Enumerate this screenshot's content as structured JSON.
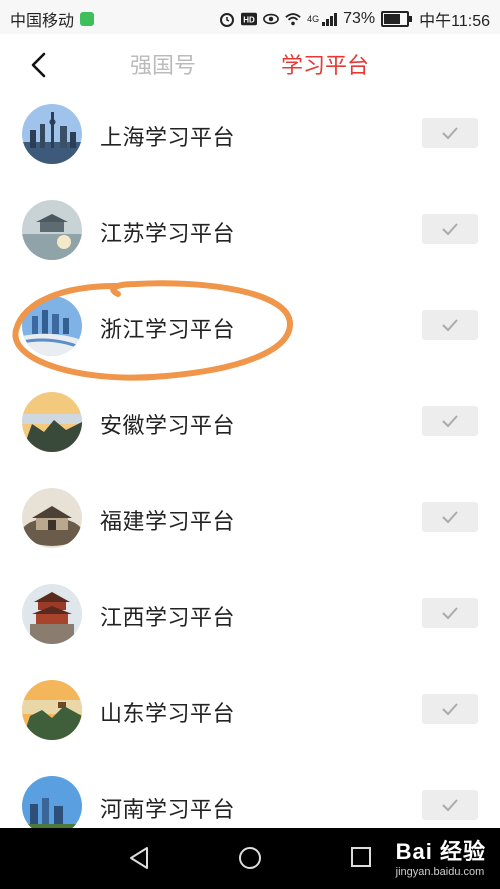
{
  "status_bar": {
    "carrier": "中国移动",
    "network": "4G",
    "battery_percent": "73%",
    "battery_level": 0.73,
    "time": "中午11:56",
    "icons": [
      "sim-icon",
      "alarm-icon",
      "hd-icon",
      "eye-icon",
      "wifi-icon",
      "signal-icon",
      "battery-icon"
    ]
  },
  "header": {
    "back_icon": "chevron-left-icon",
    "tabs": [
      {
        "label": "强国号",
        "active": false
      },
      {
        "label": "学习平台",
        "active": true
      }
    ],
    "accent": "#e53935"
  },
  "platforms": [
    {
      "label": "上海学习平台",
      "checked": true
    },
    {
      "label": "江苏学习平台",
      "checked": true
    },
    {
      "label": "浙江学习平台",
      "checked": true,
      "highlighted": true
    },
    {
      "label": "安徽学习平台",
      "checked": true
    },
    {
      "label": "福建学习平台",
      "checked": true
    },
    {
      "label": "江西学习平台",
      "checked": true
    },
    {
      "label": "山东学习平台",
      "checked": true
    },
    {
      "label": "河南学习平台",
      "checked": true
    }
  ],
  "annotation_color": "#f0964a",
  "nav_bar": {
    "buttons": [
      "back-triangle-icon",
      "home-circle-icon",
      "recents-square-icon"
    ]
  },
  "watermark": {
    "main": "Bai 经验",
    "sub": "jingyan.baidu.com"
  }
}
